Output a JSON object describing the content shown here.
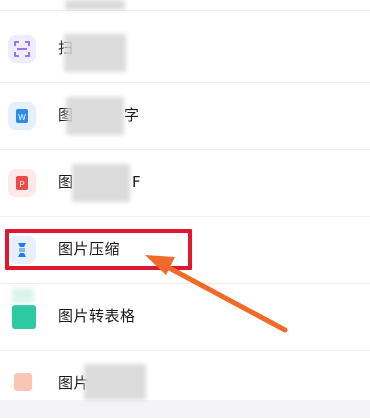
{
  "colors": {
    "accent_red": "#e0182f",
    "arrow_orange": "#f06a2b",
    "scan_purple": "#8b6cf0",
    "word_blue": "#2f8ce8",
    "pdf_red": "#ee4a4a",
    "compress_blue": "#1e7df0",
    "table_green": "#2cc9a2"
  },
  "menu": {
    "items": [
      {
        "label_visible": "扫",
        "tail": "",
        "icon": "scan-icon"
      },
      {
        "label_visible": "图",
        "tail": "字",
        "icon": "word-icon"
      },
      {
        "label_visible": "图",
        "tail": "F",
        "icon": "pdf-icon"
      },
      {
        "label_visible": "图片压缩",
        "tail": "",
        "icon": "compress-icon",
        "highlighted": true
      },
      {
        "label_visible": "图片转表格",
        "tail": "",
        "icon": "table-icon"
      },
      {
        "label_visible": "图片",
        "tail": "",
        "icon": "image-icon"
      }
    ]
  }
}
